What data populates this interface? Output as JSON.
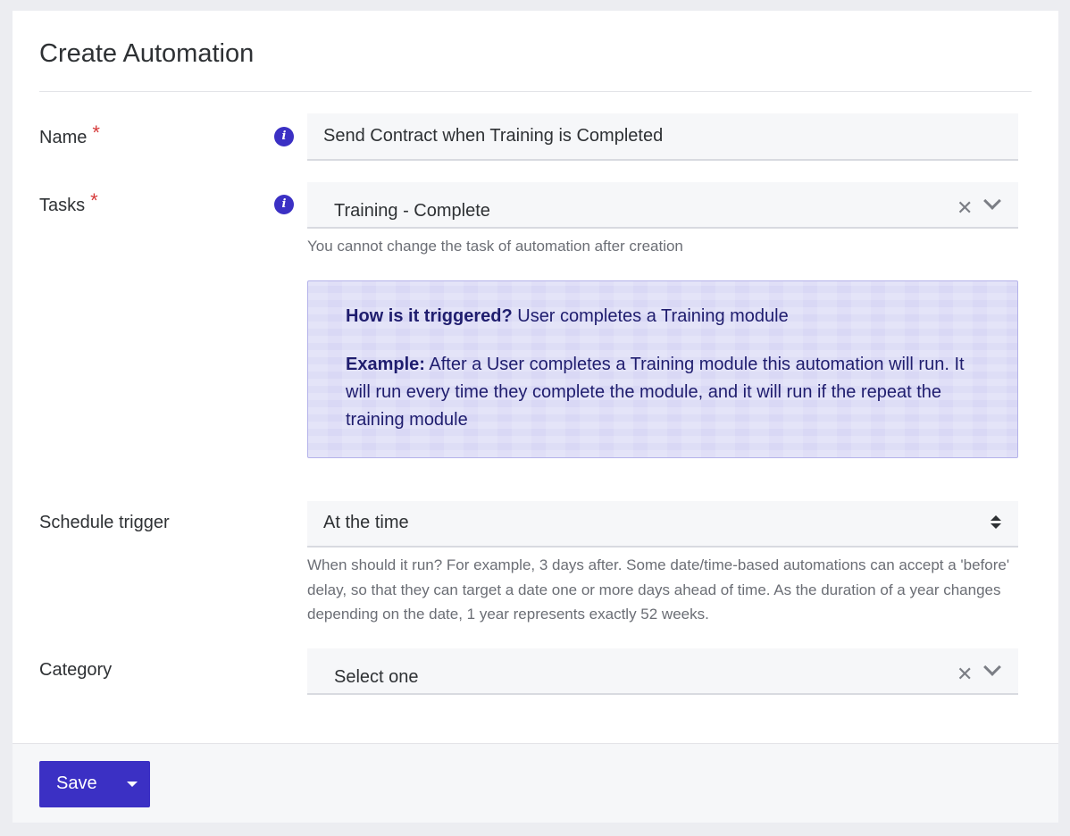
{
  "page": {
    "title": "Create Automation"
  },
  "form": {
    "name": {
      "label": "Name",
      "required_mark": "*",
      "value": "Send Contract when Training is Completed"
    },
    "tasks": {
      "label": "Tasks",
      "required_mark": "*",
      "value": "Training - Complete",
      "help": "You cannot change the task of automation after creation"
    },
    "callout": {
      "trigger_heading": "How is it triggered?",
      "trigger_text": " User completes a Training module",
      "example_heading": "Example:",
      "example_text": " After a User completes a Training module this automation will run. It will run every time they complete the module, and it will run if the repeat the training module"
    },
    "schedule_trigger": {
      "label": "Schedule trigger",
      "value": "At the time",
      "help": "When should it run? For example, 3 days after. Some date/time-based automations can accept a 'before' delay, so that they can target a date one or more days ahead of time. As the duration of a year changes depending on the date, 1 year represents exactly 52 weeks."
    },
    "category": {
      "label": "Category",
      "value": "Select one"
    }
  },
  "footer": {
    "save_label": "Save"
  },
  "icons": {
    "info": "info-icon",
    "clear": "close-icon",
    "dropdown": "chevron-down-icon",
    "sort": "sort-icon",
    "caret": "caret-down-icon"
  },
  "colors": {
    "accent": "#3b30c4",
    "required": "#d63a3a",
    "callout_bg": "#d9d8f5",
    "callout_text": "#1f1d6e"
  }
}
